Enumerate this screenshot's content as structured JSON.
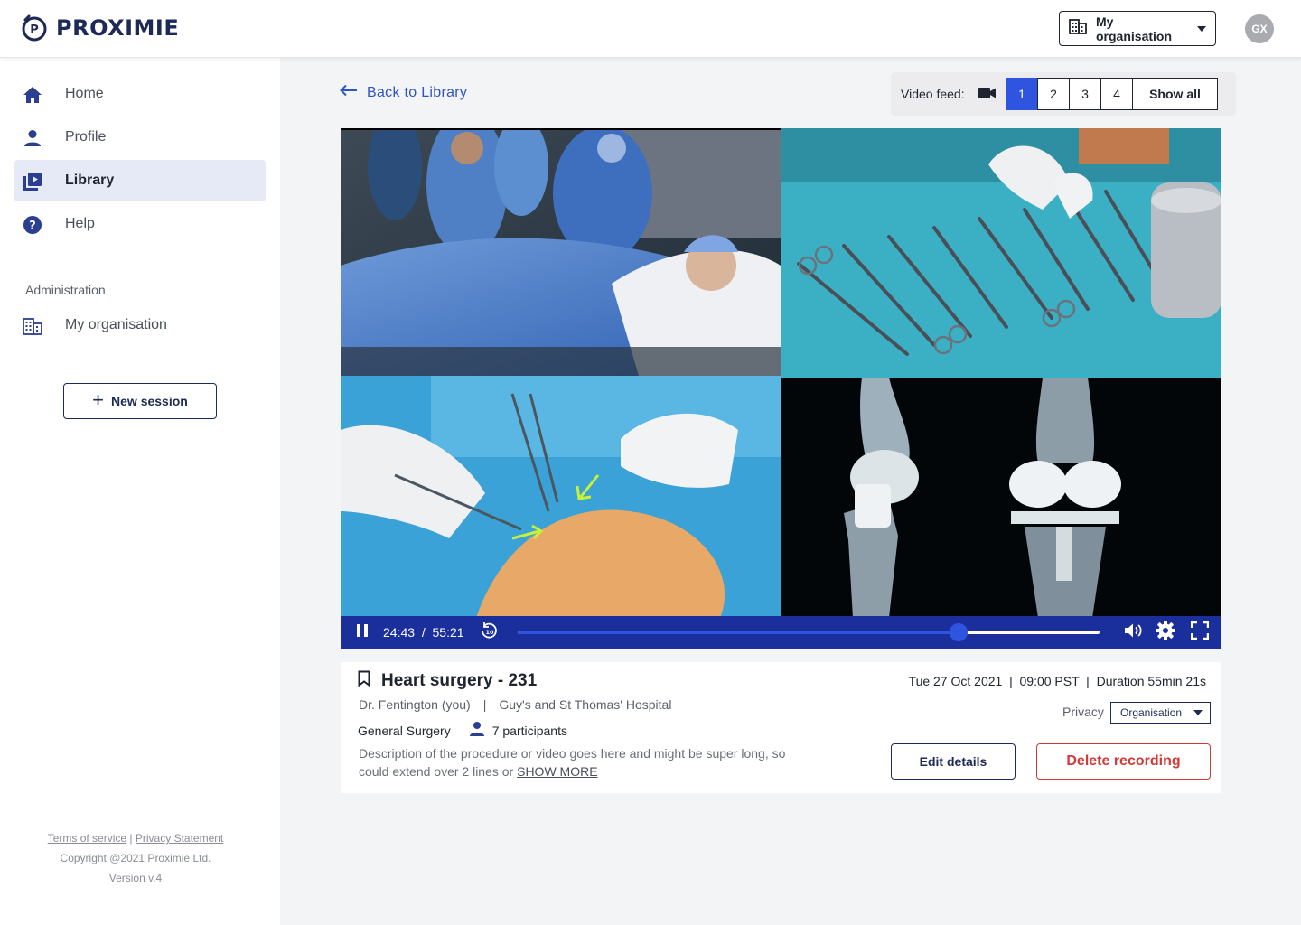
{
  "header": {
    "brand": "PROXIMIE",
    "org_button_label": "My organisation",
    "avatar_initials": "GX"
  },
  "sidebar": {
    "items": [
      {
        "label": "Home",
        "icon": "home-icon",
        "active": false
      },
      {
        "label": "Profile",
        "icon": "person-icon",
        "active": false
      },
      {
        "label": "Library",
        "icon": "video-library-icon",
        "active": true
      },
      {
        "label": "Help",
        "icon": "help-icon",
        "active": false
      }
    ],
    "admin_section_label": "Administration",
    "admin_items": [
      {
        "label": "My organisation",
        "icon": "building-icon"
      }
    ],
    "new_session_label": "New session",
    "footer": {
      "terms": "Terms of service",
      "separator": "|",
      "privacy": "Privacy Statement",
      "copyright": "Copyright @2021 Proximie Ltd.",
      "version": "Version v.4"
    }
  },
  "main": {
    "back_label": "Back to Library",
    "video_feed": {
      "label": "Video feed:",
      "options": [
        "1",
        "2",
        "3",
        "4"
      ],
      "selected": "1",
      "show_all_label": "Show all"
    },
    "player": {
      "current_time": "24:43",
      "time_separator": "/",
      "duration": "55:21",
      "progress": 0.758,
      "rewind_seconds": "10"
    },
    "recording": {
      "title": "Heart surgery - 231",
      "surgeon": "Dr. Fentington (you)",
      "meta_separator": "|",
      "hospital": "Guy's and St Thomas' Hospital",
      "specialty": "General Surgery",
      "participants": "7 participants",
      "description": "Description of the procedure or video goes here and might be super long, so could extend over 2 lines or",
      "show_more": "SHOW MORE",
      "dateline": "Tue 27 Oct 2021  |  09:00 PST  |  Duration 55min 21s",
      "privacy_label": "Privacy",
      "privacy_value": "Organisation",
      "edit_label": "Edit details",
      "delete_label": "Delete recording"
    }
  },
  "colors": {
    "primary": "#1d2a55",
    "accent": "#2f54e0",
    "controls_bar": "#1a2f9c",
    "danger": "#d23a36",
    "active_nav_bg": "#e6e9f6"
  }
}
